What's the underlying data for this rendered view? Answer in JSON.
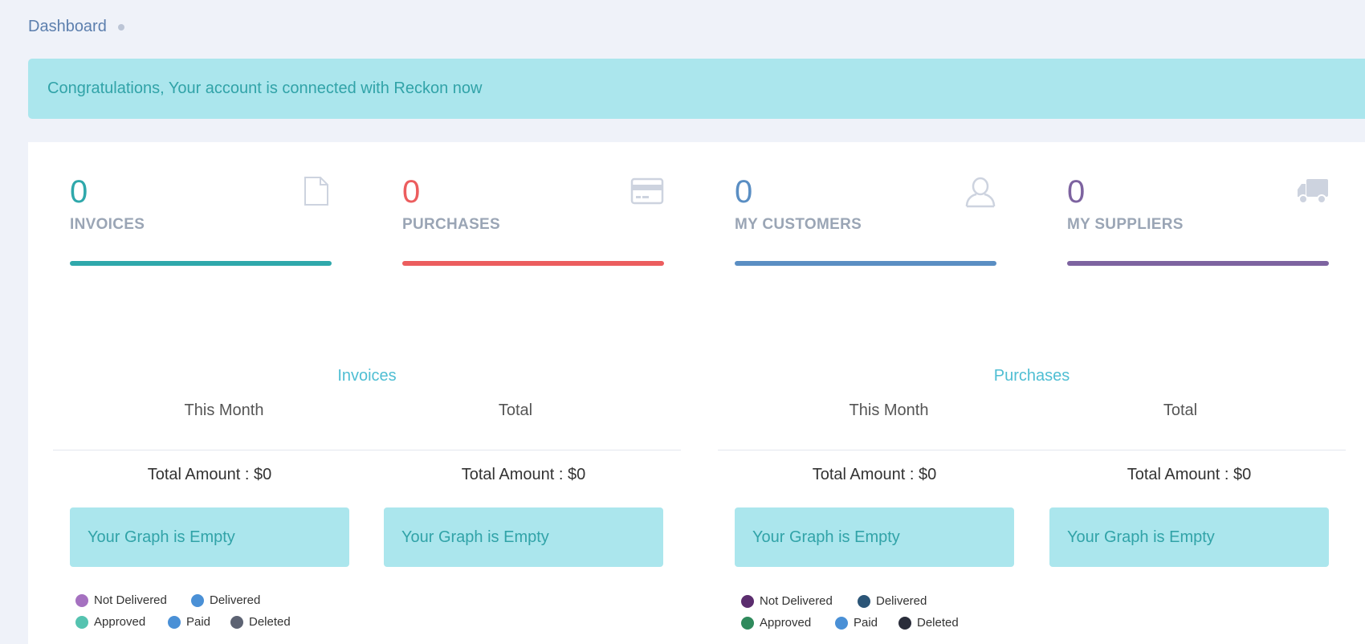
{
  "breadcrumb": {
    "label": "Dashboard"
  },
  "alert": {
    "text": "Congratulations, Your account is connected with Reckon now"
  },
  "stats": [
    {
      "value": "0",
      "label": "INVOICES",
      "color": "#2fa8ab",
      "icon": "document-icon"
    },
    {
      "value": "0",
      "label": "PURCHASES",
      "color": "#ec5d5e",
      "icon": "credit-card-icon"
    },
    {
      "value": "0",
      "label": "MY CUSTOMERS",
      "color": "#5a8ec3",
      "icon": "user-icon"
    },
    {
      "value": "0",
      "label": "MY SUPPLIERS",
      "color": "#7d63a0",
      "icon": "truck-icon"
    }
  ],
  "sections": [
    {
      "title": "Invoices",
      "columns": [
        {
          "heading": "This Month",
          "amount": "Total Amount : $0",
          "empty": "Your Graph is Empty"
        },
        {
          "heading": "Total",
          "amount": "Total Amount : $0",
          "empty": "Your Graph is Empty"
        }
      ],
      "legend": [
        {
          "label": "Not Delivered",
          "color": "#a571c0"
        },
        {
          "label": "Delivered",
          "color": "#4a90d6"
        },
        {
          "label": "Approved",
          "color": "#55c3b0"
        },
        {
          "label": "Paid",
          "color": "#4a90d6"
        },
        {
          "label": "Deleted",
          "color": "#5d6373"
        }
      ]
    },
    {
      "title": "Purchases",
      "columns": [
        {
          "heading": "This Month",
          "amount": "Total Amount : $0",
          "empty": "Your Graph is Empty"
        },
        {
          "heading": "Total",
          "amount": "Total Amount : $0",
          "empty": "Your Graph is Empty"
        }
      ],
      "legend": [
        {
          "label": "Not Delivered",
          "color": "#5b2d6e"
        },
        {
          "label": "Delivered",
          "color": "#2b5577"
        },
        {
          "label": "Approved",
          "color": "#2f8a5c"
        },
        {
          "label": "Paid",
          "color": "#4a90d6"
        },
        {
          "label": "Deleted",
          "color": "#2a2d3a"
        }
      ]
    }
  ]
}
